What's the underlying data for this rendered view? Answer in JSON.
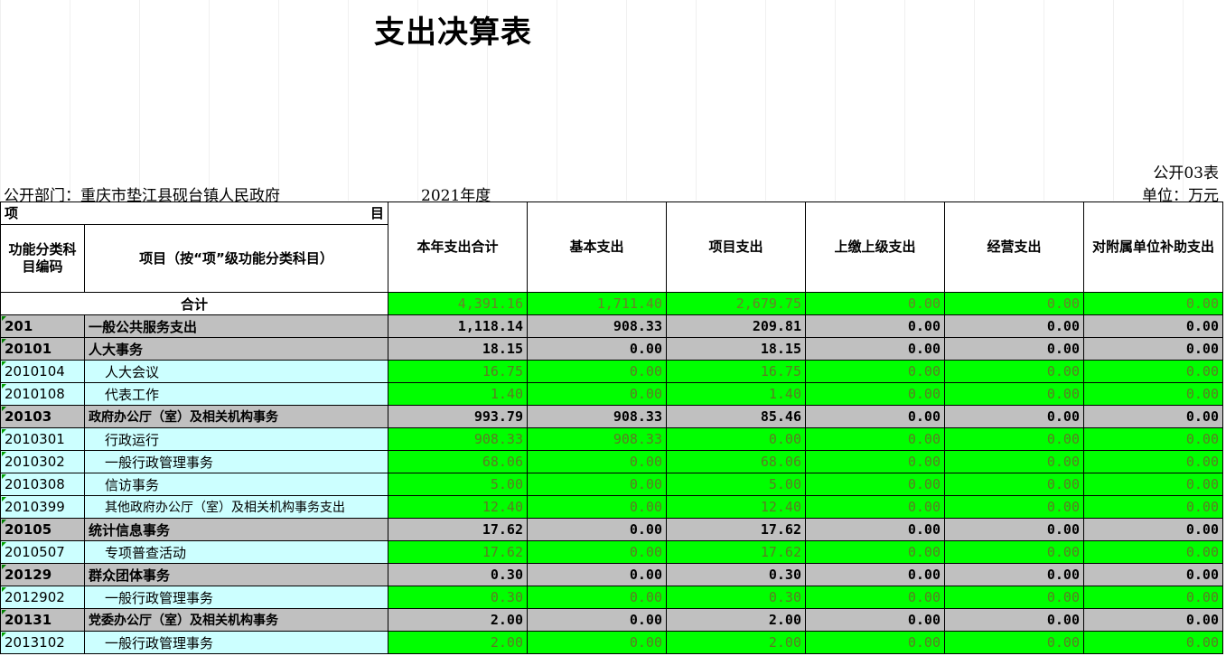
{
  "report": {
    "title": "支出决算表",
    "form_no": "公开03表",
    "dept": "公开部门：重庆市垫江县砚台镇人民政府",
    "year": "2021年度",
    "unit": "单位：万元"
  },
  "header": {
    "item_left": "项",
    "item_right": "目",
    "code": "功能分类科目编码",
    "name": "项目（按“项”级功能分类科目）",
    "cols": [
      "本年支出合计",
      "基本支出",
      "项目支出",
      "上缴上级支出",
      "经营支出",
      "对附属单位补助支出"
    ]
  },
  "total": {
    "label": "合计",
    "values": [
      "4,391.16",
      "1,711.40",
      "2,679.75",
      "0.00",
      "0.00",
      "0.00"
    ]
  },
  "rows": [
    {
      "code": "201",
      "name": "一般公共服务支出",
      "kind": "g",
      "values": [
        "1,118.14",
        "908.33",
        "209.81",
        "0.00",
        "0.00",
        "0.00"
      ]
    },
    {
      "code": "20101",
      "name": "人大事务",
      "kind": "g",
      "values": [
        "18.15",
        "0.00",
        "18.15",
        "0.00",
        "0.00",
        "0.00"
      ]
    },
    {
      "code": "2010104",
      "name": "人大会议",
      "kind": "d",
      "values": [
        "16.75",
        "0.00",
        "16.75",
        "0.00",
        "0.00",
        "0.00"
      ]
    },
    {
      "code": "2010108",
      "name": "代表工作",
      "kind": "d",
      "values": [
        "1.40",
        "0.00",
        "1.40",
        "0.00",
        "0.00",
        "0.00"
      ]
    },
    {
      "code": "20103",
      "name": "政府办公厅（室）及相关机构事务",
      "kind": "g",
      "values": [
        "993.79",
        "908.33",
        "85.46",
        "0.00",
        "0.00",
        "0.00"
      ]
    },
    {
      "code": "2010301",
      "name": "行政运行",
      "kind": "d",
      "values": [
        "908.33",
        "908.33",
        "0.00",
        "0.00",
        "0.00",
        "0.00"
      ]
    },
    {
      "code": "2010302",
      "name": "一般行政管理事务",
      "kind": "d",
      "values": [
        "68.06",
        "0.00",
        "68.06",
        "0.00",
        "0.00",
        "0.00"
      ]
    },
    {
      "code": "2010308",
      "name": "信访事务",
      "kind": "d",
      "values": [
        "5.00",
        "0.00",
        "5.00",
        "0.00",
        "0.00",
        "0.00"
      ]
    },
    {
      "code": "2010399",
      "name": "其他政府办公厅（室）及相关机构事务支出",
      "kind": "d",
      "values": [
        "12.40",
        "0.00",
        "12.40",
        "0.00",
        "0.00",
        "0.00"
      ]
    },
    {
      "code": "20105",
      "name": "统计信息事务",
      "kind": "g",
      "values": [
        "17.62",
        "0.00",
        "17.62",
        "0.00",
        "0.00",
        "0.00"
      ]
    },
    {
      "code": "2010507",
      "name": "专项普查活动",
      "kind": "d",
      "values": [
        "17.62",
        "0.00",
        "17.62",
        "0.00",
        "0.00",
        "0.00"
      ]
    },
    {
      "code": "20129",
      "name": "群众团体事务",
      "kind": "g",
      "values": [
        "0.30",
        "0.00",
        "0.30",
        "0.00",
        "0.00",
        "0.00"
      ]
    },
    {
      "code": "2012902",
      "name": "一般行政管理事务",
      "kind": "d",
      "values": [
        "0.30",
        "0.00",
        "0.30",
        "0.00",
        "0.00",
        "0.00"
      ]
    },
    {
      "code": "20131",
      "name": "党委办公厅（室）及相关机构事务",
      "kind": "g",
      "values": [
        "2.00",
        "0.00",
        "2.00",
        "0.00",
        "0.00",
        "0.00"
      ]
    },
    {
      "code": "2013102",
      "name": "一般行政管理事务",
      "kind": "d",
      "values": [
        "2.00",
        "0.00",
        "2.00",
        "0.00",
        "0.00",
        "0.00"
      ]
    }
  ],
  "colors": {
    "green_fill": "#00ff00",
    "gray_fill": "#c0c0c0",
    "cyan_fill": "#ccffff"
  }
}
